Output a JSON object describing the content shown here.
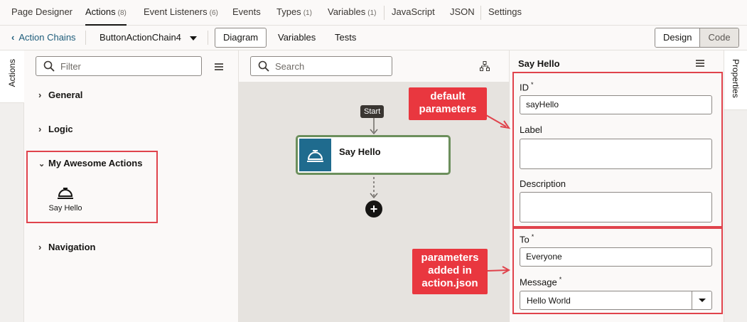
{
  "top_tabs": [
    {
      "label": "Page Designer",
      "count": ""
    },
    {
      "label": "Actions",
      "count": "(8)"
    },
    {
      "label": "Event Listeners",
      "count": "(6)"
    },
    {
      "label": "Events",
      "count": ""
    },
    {
      "label": "Types",
      "count": "(1)"
    },
    {
      "label": "Variables",
      "count": "(1)"
    },
    {
      "label": "JavaScript",
      "count": ""
    },
    {
      "label": "JSON",
      "count": ""
    },
    {
      "label": "Settings",
      "count": ""
    }
  ],
  "toolbar": {
    "back_label": "Action Chains",
    "chain_name": "ButtonActionChain4",
    "view_tabs": [
      "Diagram",
      "Variables",
      "Tests"
    ],
    "mode_design": "Design",
    "mode_code": "Code"
  },
  "left_tab": {
    "label": "Actions"
  },
  "actions_panel": {
    "filter_placeholder": "Filter",
    "sections": [
      {
        "label": "General",
        "expanded": false
      },
      {
        "label": "Logic",
        "expanded": false
      },
      {
        "label": "My Awesome Actions",
        "expanded": true
      },
      {
        "label": "Navigation",
        "expanded": false
      }
    ],
    "custom_action_label": "Say Hello"
  },
  "canvas": {
    "search_placeholder": "Search",
    "start_label": "Start",
    "node_title": "Say Hello"
  },
  "properties": {
    "title": "Say Hello",
    "fields": {
      "id": {
        "label": "ID",
        "required": "*",
        "value": "sayHello"
      },
      "label": {
        "label": "Label",
        "value": ""
      },
      "description": {
        "label": "Description",
        "value": ""
      },
      "to": {
        "label": "To",
        "required": "*",
        "value": "Everyone"
      },
      "message": {
        "label": "Message",
        "required": "*",
        "value": "Hello World"
      }
    }
  },
  "right_tab": {
    "label": "Properties"
  },
  "annotations": {
    "callout_default": "default parameters",
    "callout_added": "parameters added in action.json"
  },
  "colors": {
    "annotation_red": "#e0434c",
    "node_border": "#6c8f5c",
    "node_icon_bg": "#1f6b8e",
    "link_color": "#1d5c7a"
  }
}
